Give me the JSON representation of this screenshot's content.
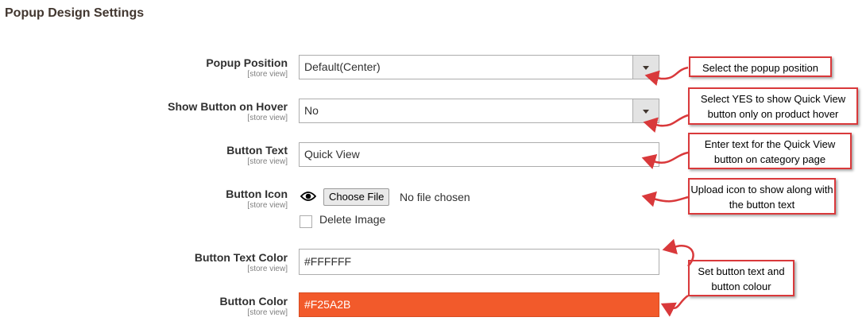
{
  "section": {
    "title": "Popup Design Settings"
  },
  "fields": {
    "popup_position": {
      "label": "Popup Position",
      "scope": "[store view]",
      "value": "Default(Center)"
    },
    "show_button_on_hover": {
      "label": "Show Button on Hover",
      "scope": "[store view]",
      "value": "No"
    },
    "button_text": {
      "label": "Button Text",
      "scope": "[store view]",
      "value": "Quick View"
    },
    "button_icon": {
      "label": "Button Icon",
      "scope": "[store view]",
      "choose_label": "Choose File",
      "no_file": "No file chosen",
      "delete_label": "Delete Image"
    },
    "button_text_color": {
      "label": "Button Text Color",
      "scope": "[store view]",
      "value": "#FFFFFF"
    },
    "button_color": {
      "label": "Button Color",
      "scope": "[store view]",
      "value": "#F25A2B"
    }
  },
  "notes": {
    "popup_position": "Select the popup position",
    "show_on_hover": "Select YES to show Quick View button only on product hover",
    "button_text": "Enter text for the Quick View button on category page",
    "button_icon": "Upload icon to show along with the button text",
    "colors": "Set button text and button colour"
  },
  "colors": {
    "accent_red": "#d9393b",
    "swatch": "#F25A2B"
  },
  "icons": {
    "eye": "eye-icon",
    "select_arrow": "chevron-down-icon"
  }
}
